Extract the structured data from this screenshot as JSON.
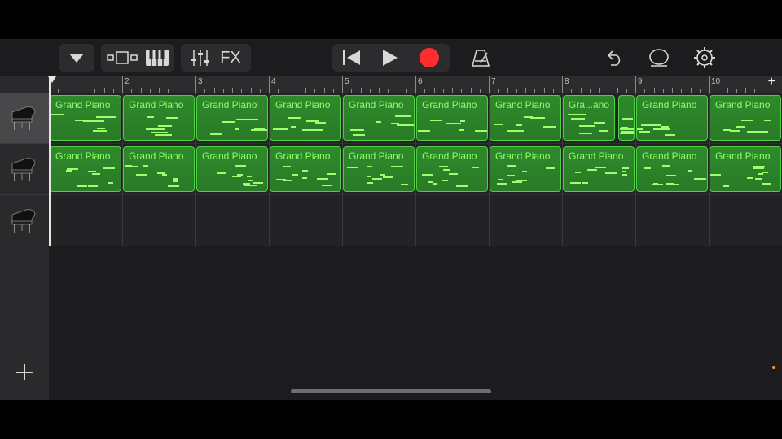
{
  "toolbar": {
    "fx_label": "FX"
  },
  "colors": {
    "background": "#1c1c1e",
    "region_fill": "#2d7d2a",
    "region_border": "#4fcf44",
    "region_text": "#8cff6e",
    "record": "#ff2d2d"
  },
  "ruler": {
    "bars": [
      "2",
      "3",
      "4",
      "5",
      "6",
      "7",
      "8",
      "9",
      "10"
    ],
    "add_label": "+"
  },
  "tracks": [
    {
      "icon": "grand-piano-icon",
      "selected": true,
      "regions": [
        "Grand Piano",
        "Grand Piano",
        "Grand Piano",
        "Grand Piano",
        "Grand Piano",
        "Grand Piano",
        "Grand Piano",
        "Gra...ano",
        "",
        "Grand Piano",
        "Grand Piano"
      ]
    },
    {
      "icon": "grand-piano-icon",
      "selected": false,
      "regions": [
        "Grand Piano",
        "Grand Piano",
        "Grand Piano",
        "Grand Piano",
        "Grand Piano",
        "Grand Piano",
        "Grand Piano",
        "Grand Piano",
        "Grand Piano",
        "Grand Piano"
      ]
    },
    {
      "icon": "grand-piano-icon",
      "selected": false,
      "regions": []
    }
  ],
  "add_track_label": "+"
}
